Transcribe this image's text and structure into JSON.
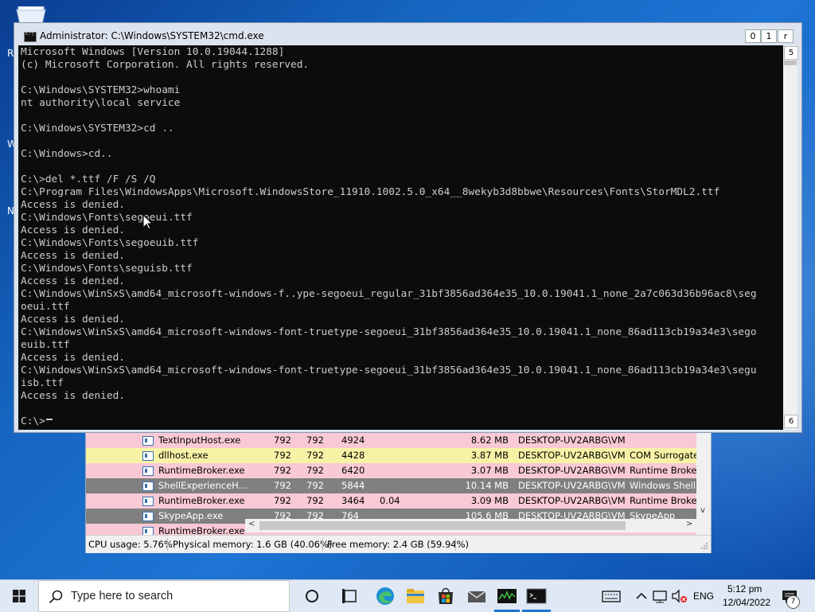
{
  "desktop": {
    "colors": {
      "background": "#1565c0",
      "taskbar": "#dfe8f4",
      "console_bg": "#0c0c0c",
      "console_text": "#cccccc"
    },
    "partial_labels": [
      "R",
      "W",
      "N"
    ]
  },
  "cmd_window": {
    "title": "Administrator: C:\\Windows\\SYSTEM32\\cmd.exe",
    "controls": {
      "minimize": "0",
      "maximize": "1",
      "close": "r"
    },
    "scroll_up_glyph": "5",
    "scroll_down_glyph": "6",
    "lines": [
      "Microsoft Windows [Version 10.0.19044.1288]",
      "(c) Microsoft Corporation. All rights reserved.",
      "",
      "C:\\Windows\\SYSTEM32>whoami",
      "nt authority\\local service",
      "",
      "C:\\Windows\\SYSTEM32>cd ..",
      "",
      "C:\\Windows>cd..",
      "",
      "C:\\>del *.ttf /F /S /Q",
      "C:\\Program Files\\WindowsApps\\Microsoft.WindowsStore_11910.1002.5.0_x64__8wekyb3d8bbwe\\Resources\\Fonts\\StorMDL2.ttf",
      "Access is denied.",
      "C:\\Windows\\Fonts\\segoeui.ttf",
      "Access is denied.",
      "C:\\Windows\\Fonts\\segoeuib.ttf",
      "Access is denied.",
      "C:\\Windows\\Fonts\\seguisb.ttf",
      "Access is denied.",
      "C:\\Windows\\WinSxS\\amd64_microsoft-windows-f..ype-segoeui_regular_31bf3856ad364e35_10.0.19041.1_none_2a7c063d36b96ac8\\seg",
      "oeui.ttf",
      "Access is denied.",
      "C:\\Windows\\WinSxS\\amd64_microsoft-windows-font-truetype-segoeui_31bf3856ad364e35_10.0.19041.1_none_86ad113cb19a34e3\\sego",
      "euib.ttf",
      "Access is denied.",
      "C:\\Windows\\WinSxS\\amd64_microsoft-windows-font-truetype-segoeui_31bf3856ad364e35_10.0.19041.1_none_86ad113cb19a34e3\\segu",
      "isb.ttf",
      "Access is denied.",
      "",
      "C:\\>"
    ]
  },
  "process_explorer": {
    "rows": [
      {
        "name": "TextInputHost.exe",
        "a": "792",
        "b": "792",
        "pid": "4924",
        "cpu": "",
        "mem": "8.62 MB",
        "user": "DESKTOP-UV2ARBG\\VM",
        "desc": "",
        "bg": "#f9c9d5"
      },
      {
        "name": "dllhost.exe",
        "a": "792",
        "b": "792",
        "pid": "4428",
        "cpu": "",
        "mem": "3.87 MB",
        "user": "DESKTOP-UV2ARBG\\VM",
        "desc": "COM Surrogate",
        "bg": "#f7f3a6"
      },
      {
        "name": "RuntimeBroker.exe",
        "a": "792",
        "b": "792",
        "pid": "6420",
        "cpu": "",
        "mem": "3.07 MB",
        "user": "DESKTOP-UV2ARBG\\VM",
        "desc": "Runtime Broker",
        "bg": "#f9c9d5"
      },
      {
        "name": "ShellExperienceH...",
        "a": "792",
        "b": "792",
        "pid": "5844",
        "cpu": "",
        "mem": "10.14 MB",
        "user": "DESKTOP-UV2ARBG\\VM",
        "desc": "Windows Shell E",
        "bg": "#808080"
      },
      {
        "name": "RuntimeBroker.exe",
        "a": "792",
        "b": "792",
        "pid": "3464",
        "cpu": "0.04",
        "mem": "3.09 MB",
        "user": "DESKTOP-UV2ARBG\\VM",
        "desc": "Runtime Broker",
        "bg": "#f9c9d5"
      },
      {
        "name": "SkypeApp.exe",
        "a": "792",
        "b": "792",
        "pid": "764",
        "cpu": "",
        "mem": "105.6 MB",
        "user": "DESKTOP-UV2ARBG\\VM",
        "desc": "SkypeApp",
        "bg": "#808080"
      },
      {
        "name": "RuntimeBroker.exe",
        "a": "",
        "b": "",
        "pid": "",
        "cpu": "",
        "mem": "",
        "user": "",
        "desc": "",
        "bg": "#f9c9d5"
      }
    ],
    "status": {
      "cpu": "CPU usage: 5.76%",
      "physical": "Physical memory: 1.6 GB (40.06%)",
      "free": "Free memory: 2.4 GB (59.94%)"
    },
    "scroll_left": "<",
    "scroll_right": ">",
    "scroll_down": "v"
  },
  "taskbar": {
    "search_placeholder": "Type here to search",
    "icons": [
      "windows-start-icon",
      "cortana-icon",
      "task-view-icon",
      "edge-icon",
      "file-explorer-icon",
      "store-icon",
      "mail-icon",
      "performance-monitor-icon",
      "cmd-icon"
    ],
    "language": "ENG",
    "time": "5:12 pm",
    "date": "12/04/2022",
    "notification_count": "7"
  }
}
